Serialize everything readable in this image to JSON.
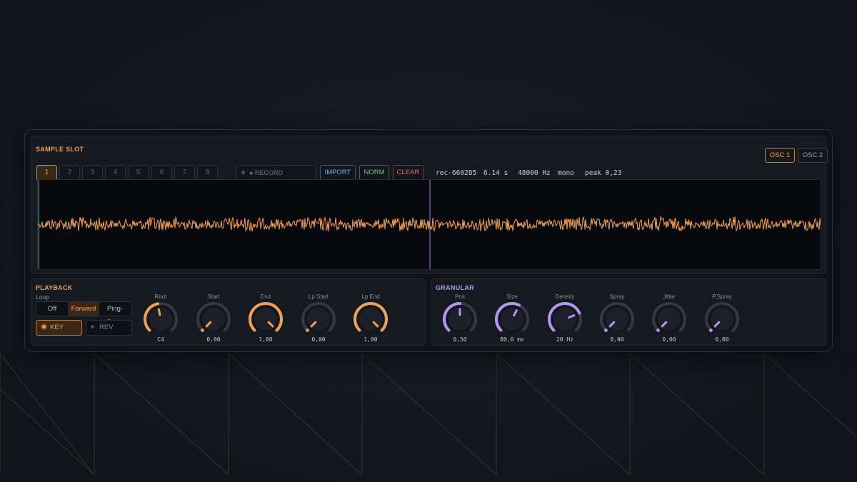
{
  "colors": {
    "accent_orange": "#f0a050",
    "accent_purple": "#b694f0",
    "wave": "#f5a04a",
    "playhead": "#9d8ad8",
    "start_marker": "#3fae7a",
    "knob_track": "#333844"
  },
  "sample_slot": {
    "title": "SAMPLE SLOT",
    "slots": [
      "1",
      "2",
      "3",
      "4",
      "5",
      "6",
      "7",
      "8"
    ],
    "active_slot": "1",
    "record_label": "● RECORD",
    "import_label": "IMPORT",
    "norm_label": "NORM",
    "clear_label": "CLEAR",
    "info": {
      "name": "rec-660285",
      "duration": "6.14 s",
      "rate": "48000 Hz",
      "channels": "mono",
      "peak": "peak 0,23"
    },
    "osc_tabs": [
      "OSC 1",
      "OSC 2"
    ],
    "active_osc": "OSC 1",
    "waveform": {
      "playhead_fraction": 0.5,
      "start_fraction": 0.0
    }
  },
  "playback": {
    "title": "PLAYBACK",
    "loop_label": "Loop",
    "loop_options": [
      "Off",
      "Forward",
      "Ping-Pong"
    ],
    "loop_selected": "Forward",
    "key_label": "KEY",
    "rev_label": "REV",
    "knobs": [
      {
        "label": "Root",
        "value": "C4",
        "fraction": 0.46
      },
      {
        "label": "Start",
        "value": "0,00",
        "fraction": 0.0
      },
      {
        "label": "End",
        "value": "1,00",
        "fraction": 1.0
      },
      {
        "label": "Lp Start",
        "value": "0,00",
        "fraction": 0.0
      },
      {
        "label": "Lp End",
        "value": "1,00",
        "fraction": 1.0
      }
    ]
  },
  "granular": {
    "title": "GRANULAR",
    "knobs": [
      {
        "label": "Pos",
        "value": "0,50",
        "fraction": 0.5
      },
      {
        "label": "Size",
        "value": "80,0 ms",
        "fraction": 0.6
      },
      {
        "label": "Density",
        "value": "20 Hz",
        "fraction": 0.75
      },
      {
        "label": "Spray",
        "value": "0,00",
        "fraction": 0.0
      },
      {
        "label": "Jitter",
        "value": "0,00",
        "fraction": 0.0
      },
      {
        "label": "P.Spray",
        "value": "0,00",
        "fraction": 0.0
      }
    ]
  }
}
